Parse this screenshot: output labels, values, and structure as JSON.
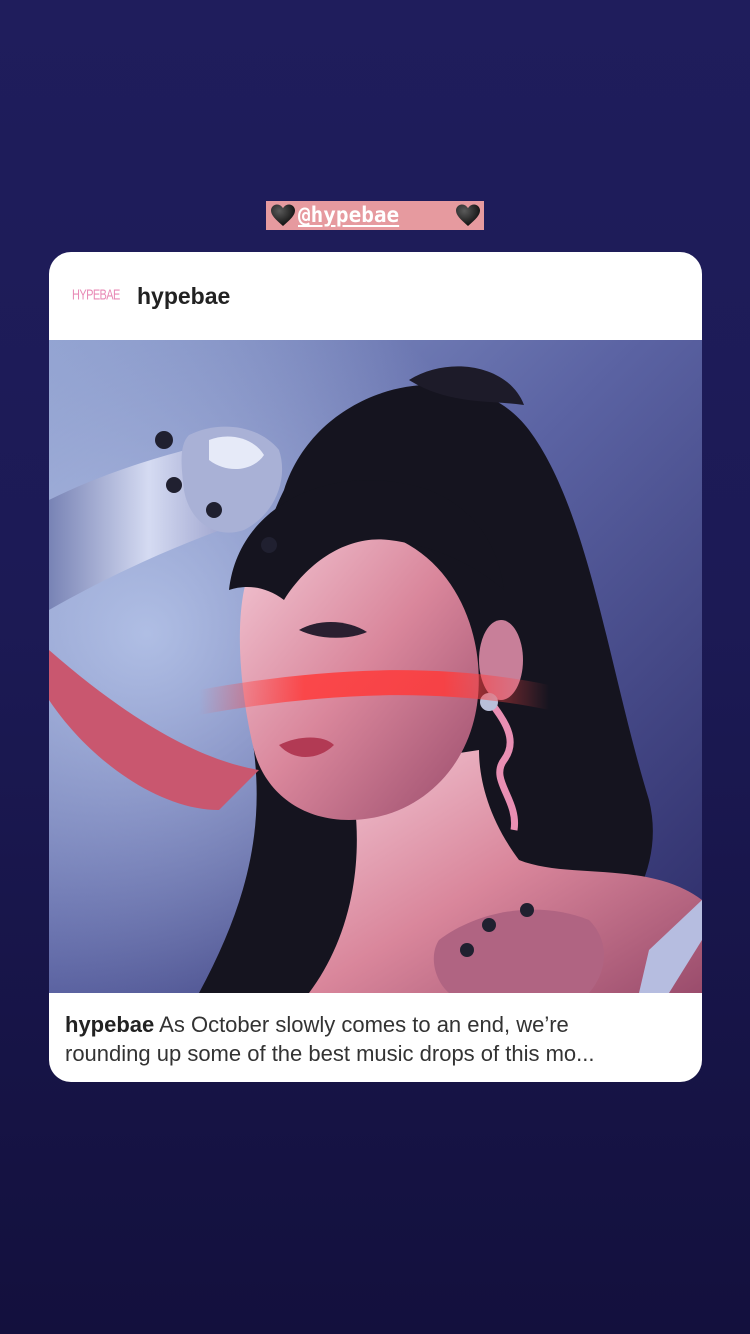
{
  "story": {
    "background_top": "#1f1d5c",
    "background_bottom": "#13103d"
  },
  "mention_sticker": {
    "text": "@hypebae",
    "left_icon": "black-heart-icon",
    "right_icon": "black-heart-icon",
    "background": "#e69a9f"
  },
  "post": {
    "logo_text": "HYPEBAE",
    "username": "hypebae",
    "image": {
      "description_icon": "portrait-photo"
    },
    "caption": {
      "username": "hypebae",
      "line1": " As October slowly comes to an end, we’re",
      "line2": "rounding up some of the best music drops of this mo..."
    }
  }
}
